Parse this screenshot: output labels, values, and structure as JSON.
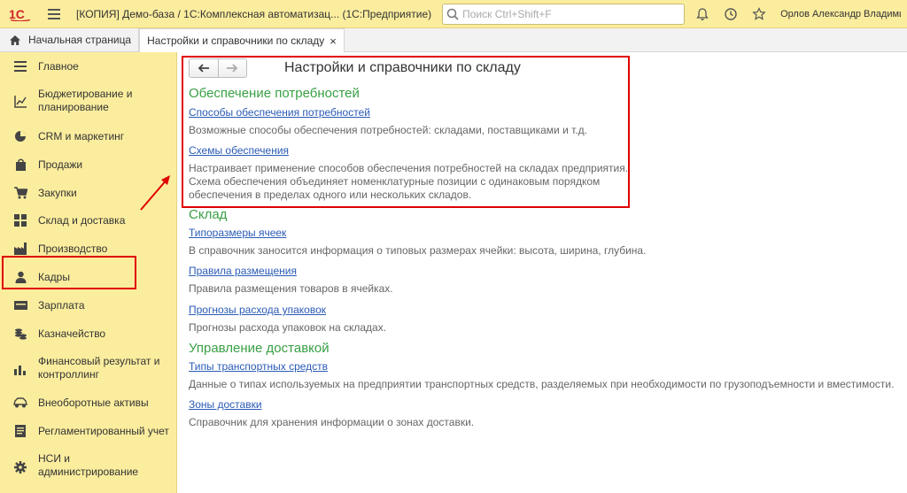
{
  "header": {
    "logo_text": "1С",
    "app_title": "[КОПИЯ] Демо-база / 1С:Комплексная автоматизац...  (1С:Предприятие)",
    "search_placeholder": "Поиск Ctrl+Shift+F",
    "user_name": "Орлов Александр Владимирович"
  },
  "tabs": [
    {
      "label": "Начальная страница"
    },
    {
      "label": "Настройки и справочники по складу",
      "close": "×"
    }
  ],
  "sidebar": {
    "items": [
      {
        "label": "Главное",
        "icon": "menu-lines-icon"
      },
      {
        "label": "Бюджетирование и планирование",
        "icon": "budget-chart-icon"
      },
      {
        "label": "CRM и маркетинг",
        "icon": "pie-chart-icon"
      },
      {
        "label": "Продажи",
        "icon": "shopping-bag-icon"
      },
      {
        "label": "Закупки",
        "icon": "cart-icon"
      },
      {
        "label": "Склад и доставка",
        "icon": "warehouse-grid-icon"
      },
      {
        "label": "Производство",
        "icon": "factory-icon"
      },
      {
        "label": "Кадры",
        "icon": "person-icon"
      },
      {
        "label": "Зарплата",
        "icon": "wallet-icon"
      },
      {
        "label": "Казначейство",
        "icon": "coins-icon"
      },
      {
        "label": "Финансовый результат и контроллинг",
        "icon": "bar-chart-icon"
      },
      {
        "label": "Внеоборотные активы",
        "icon": "car-icon"
      },
      {
        "label": "Регламентированный учет",
        "icon": "document-icon"
      },
      {
        "label": "НСИ и администрирование",
        "icon": "gear-icon"
      }
    ],
    "selected": "Склад и доставка"
  },
  "main": {
    "title": "Настройки и справочники по складу",
    "groups": [
      {
        "title": "Обеспечение потребностей",
        "entries": [
          {
            "link": "Способы обеспечения потребностей",
            "desc": [
              "Возможные способы обеспечения потребностей: складами, поставщиками и т.д."
            ]
          },
          {
            "link": "Схемы обеспечения",
            "desc": [
              "Настраивает применение способов обеспечения потребностей на складах предприятия.",
              "Схема обеспечения объединяет номенклатурные позиции с одинаковым порядком",
              "обеспечения в пределах одного или нескольких складов."
            ]
          }
        ]
      },
      {
        "title": "Склад",
        "entries": [
          {
            "link": "Типоразмеры ячеек",
            "desc": [
              "В справочник заносится информация о типовых размерах ячейки: высота, ширина, глубина."
            ]
          },
          {
            "link": "Правила размещения",
            "desc": [
              "Правила размещения товаров в ячейках."
            ]
          },
          {
            "link": "Прогнозы расхода упаковок",
            "desc": [
              "Прогнозы расхода упаковок на складах."
            ]
          }
        ]
      },
      {
        "title": "Управление доставкой",
        "entries": [
          {
            "link": "Типы транспортных средств",
            "desc": [
              "Данные о типах используемых на предприятии транспортных средств, разделяемых при необходимости по грузоподъемности и вместимости."
            ]
          },
          {
            "link": "Зоны доставки",
            "desc": [
              "Справочник для хранения информации о зонах доставки."
            ]
          }
        ]
      }
    ]
  },
  "colors": {
    "accent_yellow": "#fbed9e",
    "group_green": "#39a045",
    "link_blue": "#2a5bb5",
    "highlight_red": "#e00000"
  }
}
